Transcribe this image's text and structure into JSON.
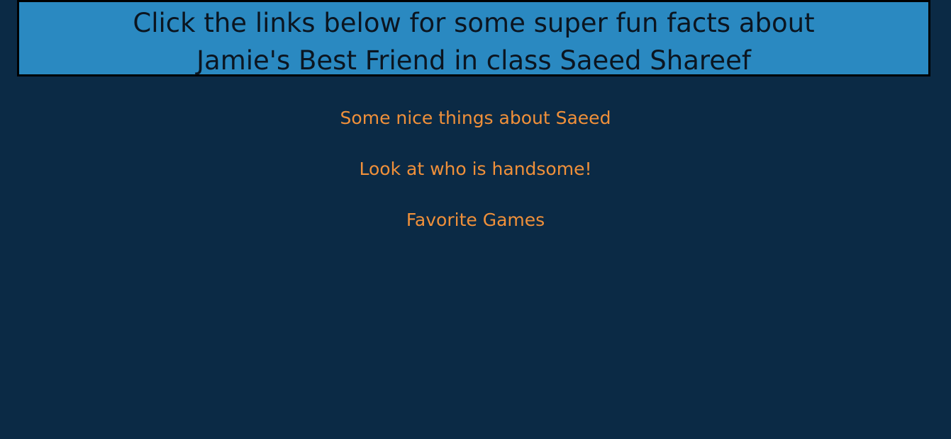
{
  "header": {
    "line1": "Click the links below for some super fun facts about",
    "line2": "Jamie's Best Friend in class Saeed Shareef"
  },
  "links": [
    {
      "label": "Some nice things about Saeed"
    },
    {
      "label": "Look at who is handsome!"
    },
    {
      "label": "Favorite Games"
    }
  ],
  "colors": {
    "background": "#0b2a45",
    "header_background": "#2a89c1",
    "header_border": "#000000",
    "header_text": "#0b1520",
    "link_text": "#f0903a"
  }
}
